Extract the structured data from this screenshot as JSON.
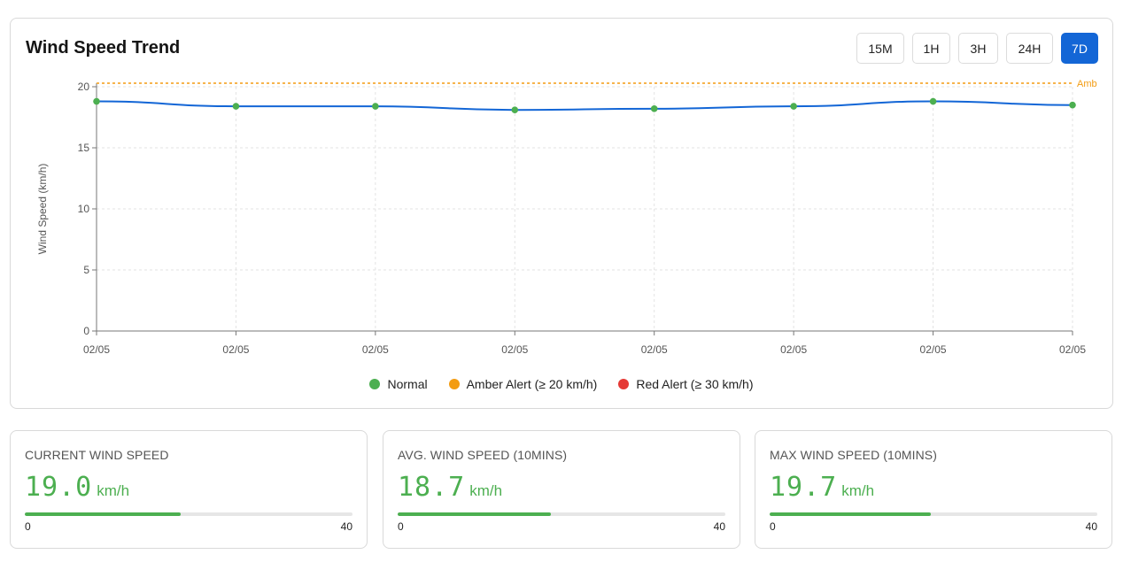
{
  "header": {
    "title": "Wind Speed Trend",
    "ranges": [
      "15M",
      "1H",
      "3H",
      "24H",
      "7D"
    ],
    "active_range": "7D"
  },
  "chart_data": {
    "type": "line",
    "ylabel": "Wind Speed (km/h)",
    "xlabel": "",
    "x": [
      "02/05",
      "02/05",
      "02/05",
      "02/05",
      "02/05",
      "02/05",
      "02/05",
      "02/05"
    ],
    "series": [
      {
        "values": [
          18.8,
          18.4,
          18.4,
          18.1,
          18.2,
          18.4,
          18.8,
          18.5
        ],
        "color": "#1366d6"
      }
    ],
    "ylim": [
      0,
      20
    ],
    "yticks": [
      0,
      5,
      10,
      15,
      20
    ],
    "threshold": {
      "value": 20,
      "label": "Amb",
      "color": "#f39c12"
    },
    "grid": true,
    "point_color": "#4caf50",
    "legend_position": "bottom",
    "legend": [
      {
        "label": "Normal",
        "color": "#4caf50"
      },
      {
        "label": "Amber Alert (≥ 20 km/h)",
        "color": "#f39c12"
      },
      {
        "label": "Red Alert (≥ 30 km/h)",
        "color": "#e53935"
      }
    ]
  },
  "stats": [
    {
      "label": "CURRENT WIND SPEED",
      "value": "19.0",
      "unit": "km/h",
      "fraction": 0.475,
      "min": "0",
      "max": "40"
    },
    {
      "label": "AVG. WIND SPEED (10MINS)",
      "value": "18.7",
      "unit": "km/h",
      "fraction": 0.4675,
      "min": "0",
      "max": "40"
    },
    {
      "label": "MAX WIND SPEED (10MINS)",
      "value": "19.7",
      "unit": "km/h",
      "fraction": 0.4925,
      "min": "0",
      "max": "40"
    }
  ]
}
